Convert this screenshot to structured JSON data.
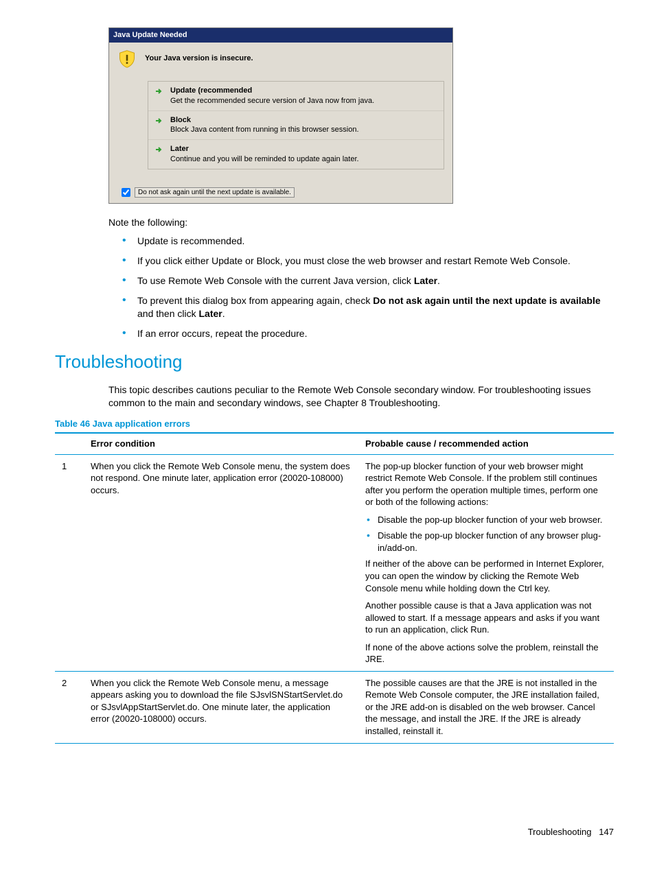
{
  "dialog": {
    "title": "Java Update Needed",
    "insecure": "Your Java version is insecure.",
    "options": [
      {
        "title": "Update (recommended",
        "desc": "Get the recommended secure version of Java now from java."
      },
      {
        "title": "Block",
        "desc": "Block Java content from running in this browser session."
      },
      {
        "title": "Later",
        "desc": "Continue and you will be reminded to update again later."
      }
    ],
    "checkbox": "Do not ask again until the next update is available."
  },
  "note_lead": "Note the following:",
  "bullets": {
    "b0": "Update is recommended.",
    "b1": "If you click either Update or Block, you must close the web browser and restart Remote Web Console.",
    "b2a": "To use Remote Web Console with the current Java version, click ",
    "b2b": "Later",
    "b2c": ".",
    "b3a": "To prevent this dialog box from appearing again, check ",
    "b3b": "Do not ask again until the next update is available",
    "b3c": " and then click ",
    "b3d": "Later",
    "b3e": ".",
    "b4": "If an error occurs, repeat the procedure."
  },
  "section_heading": "Troubleshooting",
  "section_desc": "This topic describes cautions peculiar to the Remote Web Console secondary window. For troubleshooting issues common to the main and secondary windows, see Chapter 8 Troubleshooting.",
  "table_caption": "Table 46 Java application errors",
  "th1": "Error condition",
  "th2": "Probable cause / recommended action",
  "row1": {
    "num": "1",
    "cond": "When you click the Remote Web Console menu, the system does not respond. One minute later, application error (20020-108000) occurs.",
    "p1": "The pop-up blocker function of your web browser might restrict Remote Web Console. If the problem still continues after you perform the operation multiple times, perform one or both of the following actions:",
    "li1": "Disable the pop-up blocker function of your web browser.",
    "li2": "Disable the pop-up blocker function of any browser plug-in/add-on.",
    "p2": "If neither of the above can be performed in Internet Explorer, you can open the window by clicking the Remote Web Console menu while holding down the Ctrl key.",
    "p3": "Another possible cause is that a Java application was not allowed to start. If a message appears and asks if you want to run an application, click Run.",
    "p4": "If none of the above actions solve the problem, reinstall the JRE."
  },
  "row2": {
    "num": "2",
    "cond": "When you click the Remote Web Console menu, a message appears asking you to download the file SJsvlSNStartServlet.do or SJsvlAppStartServlet.do. One minute later, the application error (20020-108000) occurs.",
    "action": "The possible causes are that the JRE is not installed in the Remote Web Console computer, the JRE installation failed, or the JRE add-on is disabled on the web browser. Cancel the message, and install the JRE. If the JRE is already installed, reinstall it."
  },
  "footer_label": "Troubleshooting",
  "footer_page": "147"
}
